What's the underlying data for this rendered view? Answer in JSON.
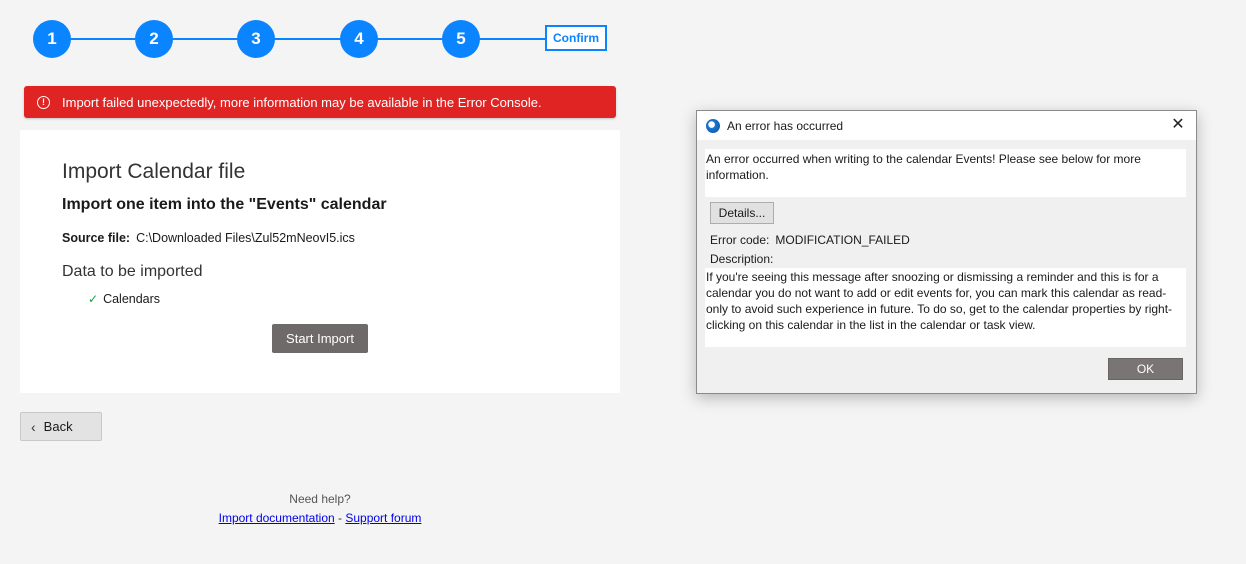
{
  "stepper": {
    "steps": [
      "1",
      "2",
      "3",
      "4",
      "5"
    ],
    "confirm_label": "Confirm",
    "accent": "#0a84ff"
  },
  "banner": {
    "icon": "error-icon",
    "text": "Import failed unexpectedly, more information may be available in the Error Console.",
    "color": "#e02424"
  },
  "card": {
    "title": "Import Calendar file",
    "subtitle": "Import one item into the \"Events\" calendar",
    "source_label": "Source file:",
    "source_value": "C:\\Downloaded Files\\Zul52mNeovI5.ics",
    "data_title": "Data to be imported",
    "items": [
      "Calendars"
    ],
    "start_button": "Start Import"
  },
  "back_button": "Back",
  "help": {
    "prompt": "Need help?",
    "link1": "Import documentation",
    "separator": " - ",
    "link2": "Support forum"
  },
  "dialog": {
    "title": "An error has occurred",
    "message": "An error occurred when writing to the calendar Events! Please see below for more information.",
    "details_button": "Details...",
    "error_code_label": "Error code:",
    "error_code_value": "MODIFICATION_FAILED",
    "description_label": "Description:",
    "description": "If you're seeing this message after snoozing or dismissing a reminder and this is for a calendar you do not want to add or edit events for, you can mark this calendar as read-only to avoid such experience in future. To do so, get to the calendar properties by right-clicking on this calendar in the list in the calendar or task view.",
    "ok_button": "OK",
    "close_icon": "close-icon"
  }
}
